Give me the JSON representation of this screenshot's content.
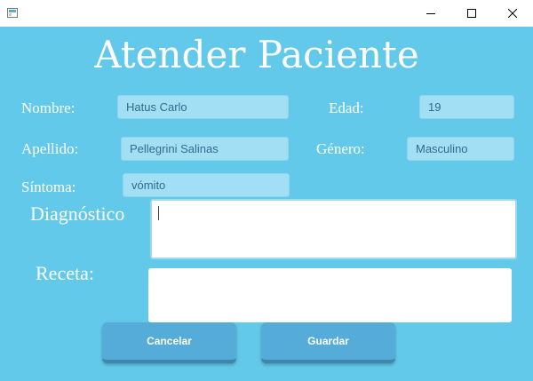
{
  "window": {
    "minimize_icon": "minimize-icon",
    "maximize_icon": "maximize-icon",
    "close_icon": "close-icon"
  },
  "form": {
    "title": "Atender Paciente",
    "nombre_label": "Nombre:",
    "nombre_value": "Hatus Carlo",
    "edad_label": "Edad:",
    "edad_value": "19",
    "apellido_label": "Apellido:",
    "apellido_value": "Pellegrini Salinas",
    "genero_label": "Género:",
    "genero_value": "Masculino",
    "sintoma_label": "Síntoma:",
    "sintoma_value": "vómito",
    "diagnostico_label": "Diagnóstico",
    "diagnostico_value": "",
    "receta_label": "Receta:",
    "receta_value": ""
  },
  "buttons": {
    "cancelar": "Cancelar",
    "guardar": "Guardar"
  },
  "colors": {
    "background": "#63c9ea",
    "field": "#a2def4",
    "button": "#55acd8"
  }
}
